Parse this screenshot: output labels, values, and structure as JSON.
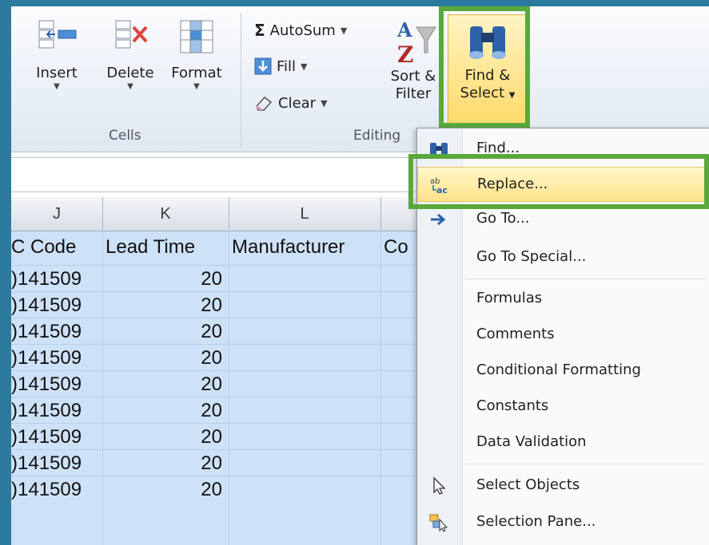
{
  "ribbon": {
    "cells": {
      "insert_label": "Insert",
      "delete_label": "Delete",
      "format_label": "Format",
      "group_label": "Cells"
    },
    "editing": {
      "autosum_label": "AutoSum",
      "fill_label": "Fill",
      "clear_label": "Clear",
      "sort_label_1": "Sort &",
      "sort_label_2": "Filter",
      "find_label_1": "Find &",
      "find_label_2": "Select",
      "group_label": "Editing"
    }
  },
  "columns": [
    "J",
    "K",
    "L"
  ],
  "table": {
    "headers": [
      "C Code",
      "Lead Time",
      "Manufacturer",
      "Co"
    ],
    "rows": [
      {
        "code": ")141509",
        "lead_time": "20"
      },
      {
        "code": ")141509",
        "lead_time": "20"
      },
      {
        "code": ")141509",
        "lead_time": "20"
      },
      {
        "code": ")141509",
        "lead_time": "20"
      },
      {
        "code": ")141509",
        "lead_time": "20"
      },
      {
        "code": ")141509",
        "lead_time": "20"
      },
      {
        "code": ")141509",
        "lead_time": "20"
      },
      {
        "code": ")141509",
        "lead_time": "20"
      },
      {
        "code": ")141509",
        "lead_time": "20"
      }
    ]
  },
  "menu": {
    "find": "Find...",
    "replace": "Replace...",
    "goto": "Go To...",
    "goto_special": "Go To Special...",
    "formulas": "Formulas",
    "comments": "Comments",
    "conditional_formatting": "Conditional Formatting",
    "constants": "Constants",
    "data_validation": "Data Validation",
    "select_objects": "Select Objects",
    "selection_pane": "Selection Pane..."
  },
  "colors": {
    "highlight_box": "#5aa83a",
    "selection": "#cde1f7",
    "menu_hover": "#ffe38a"
  }
}
